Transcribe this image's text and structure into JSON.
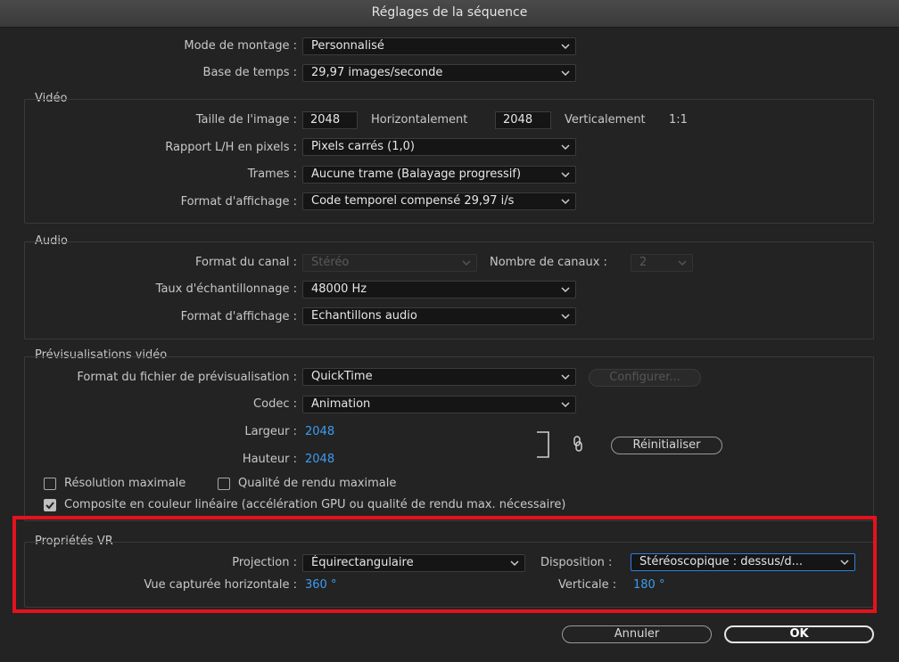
{
  "window": {
    "title": "Réglages de la séquence"
  },
  "general": {
    "editing_mode_label": "Mode de montage :",
    "editing_mode_value": "Personnalisé",
    "timebase_label": "Base de temps :",
    "timebase_value": "29,97  images/seconde"
  },
  "video": {
    "title": "Vidéo",
    "frame_size_label": "Taille de l'image :",
    "width_value": "2048",
    "horizontal_label": "Horizontalement",
    "height_value": "2048",
    "vertical_label": "Verticalement",
    "ratio": "1:1",
    "pixel_aspect_label": "Rapport L/H en pixels :",
    "pixel_aspect_value": "Pixels carrés (1,0)",
    "fields_label": "Trames :",
    "fields_value": "Aucune trame (Balayage progressif)",
    "display_format_label": "Format d'affichage :",
    "display_format_value": "Code temporel compensé 29,97 i/s"
  },
  "audio": {
    "title": "Audio",
    "channel_format_label": "Format du canal :",
    "channel_format_value": "Stéréo",
    "channel_count_label": "Nombre de canaux :",
    "channel_count_value": "2",
    "sample_rate_label": "Taux d'échantillonnage :",
    "sample_rate_value": "48000 Hz",
    "display_format_label": "Format d'affichage :",
    "display_format_value": "Echantillons audio"
  },
  "preview": {
    "title": "Prévisualisations vidéo",
    "file_format_label": "Format du fichier de prévisualisation :",
    "file_format_value": "QuickTime",
    "configure_label": "Configurer...",
    "codec_label": "Codec :",
    "codec_value": "Animation",
    "width_label": "Largeur :",
    "width_value": "2048",
    "height_label": "Hauteur :",
    "height_value": "2048",
    "reset_label": "Réinitialiser",
    "max_res_label": "Résolution maximale",
    "max_quality_label": "Qualité de rendu maximale",
    "linear_label": "Composite en couleur linéaire (accélération GPU ou qualité de rendu max. nécessaire)"
  },
  "vr": {
    "title": "Propriétés VR",
    "projection_label": "Projection :",
    "projection_value": "Équirectangulaire",
    "layout_label": "Disposition :",
    "layout_value": "Stéréoscopique : dessus/d...",
    "h_view_label": "Vue capturée horizontale :",
    "h_view_value": "360 °",
    "vertical_label": "Verticale :",
    "vertical_value": "180 °"
  },
  "footer": {
    "cancel_label": "Annuler",
    "ok_label": "OK"
  },
  "colors": {
    "accent_blue": "#3d9cf0",
    "highlight_red": "#e5121e",
    "focus_blue": "#2f7ee0"
  }
}
